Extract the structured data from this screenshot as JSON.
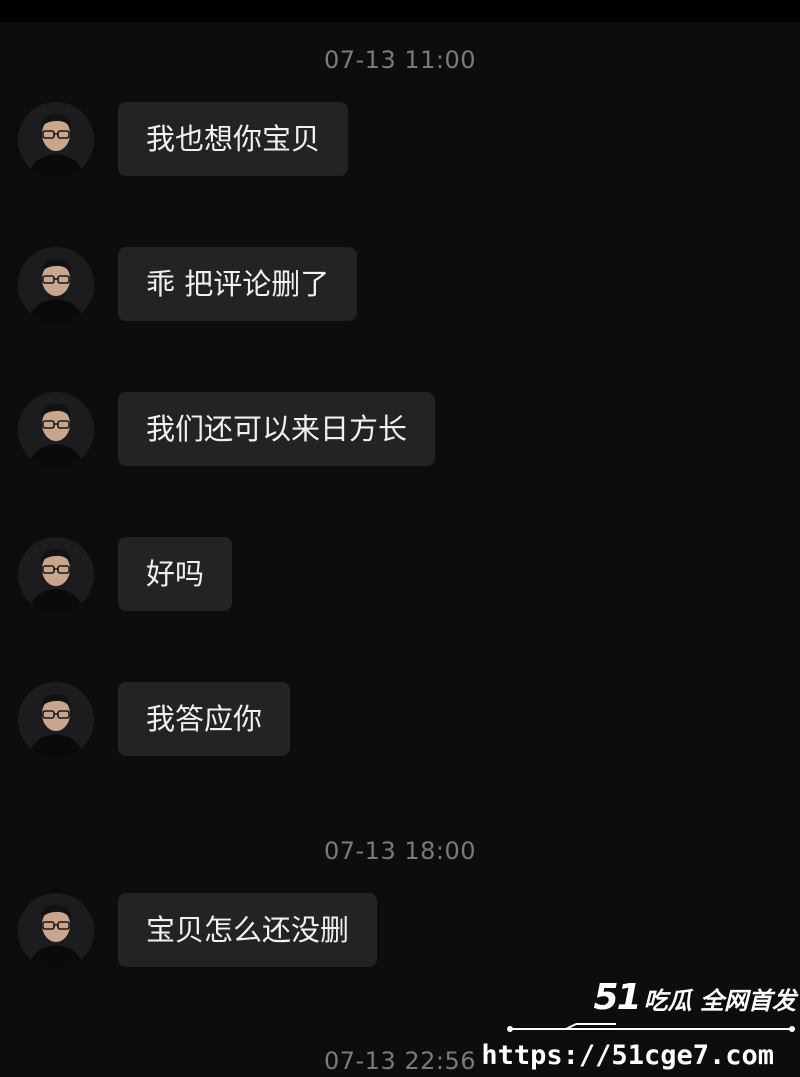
{
  "chat": {
    "timestamps": [
      "07-13 11:00",
      "07-13 18:00",
      "07-13 22:56"
    ],
    "messages": [
      {
        "text": "我也想你宝贝"
      },
      {
        "text": "乖 把评论删了"
      },
      {
        "text": "我们还可以来日方长"
      },
      {
        "text": "好吗"
      },
      {
        "text": "我答应你"
      },
      {
        "text": "宝贝怎么还没删"
      }
    ]
  },
  "watermark": {
    "number": "51",
    "slogan": "吃瓜 全网首发",
    "url": "https://51cge7.com"
  },
  "colors": {
    "background": "#0d0d0f",
    "bubble": "#232326",
    "timestamp_text": "#7a7a7e",
    "message_text": "#f0f0f0"
  },
  "icons": {
    "avatar": "avatar-photo"
  }
}
